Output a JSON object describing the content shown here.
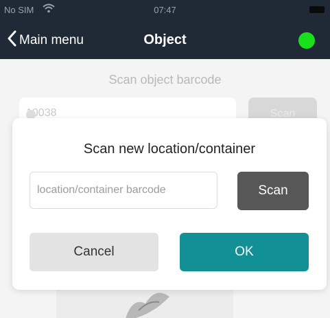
{
  "statusbar": {
    "carrier": "No SIM",
    "time": "07:47"
  },
  "nav": {
    "back_label": "Main menu",
    "title": "Object",
    "status_color": "#19e01b"
  },
  "background": {
    "scan_label": "Scan object barcode",
    "object_value": "10038",
    "scan_button": "Scan"
  },
  "modal": {
    "title": "Scan new location/container",
    "input_placeholder": "location/container barcode",
    "input_value": "",
    "scan_button": "Scan",
    "cancel_button": "Cancel",
    "ok_button": "OK"
  },
  "colors": {
    "accent": "#129096",
    "navbar": "#1f2a36"
  }
}
